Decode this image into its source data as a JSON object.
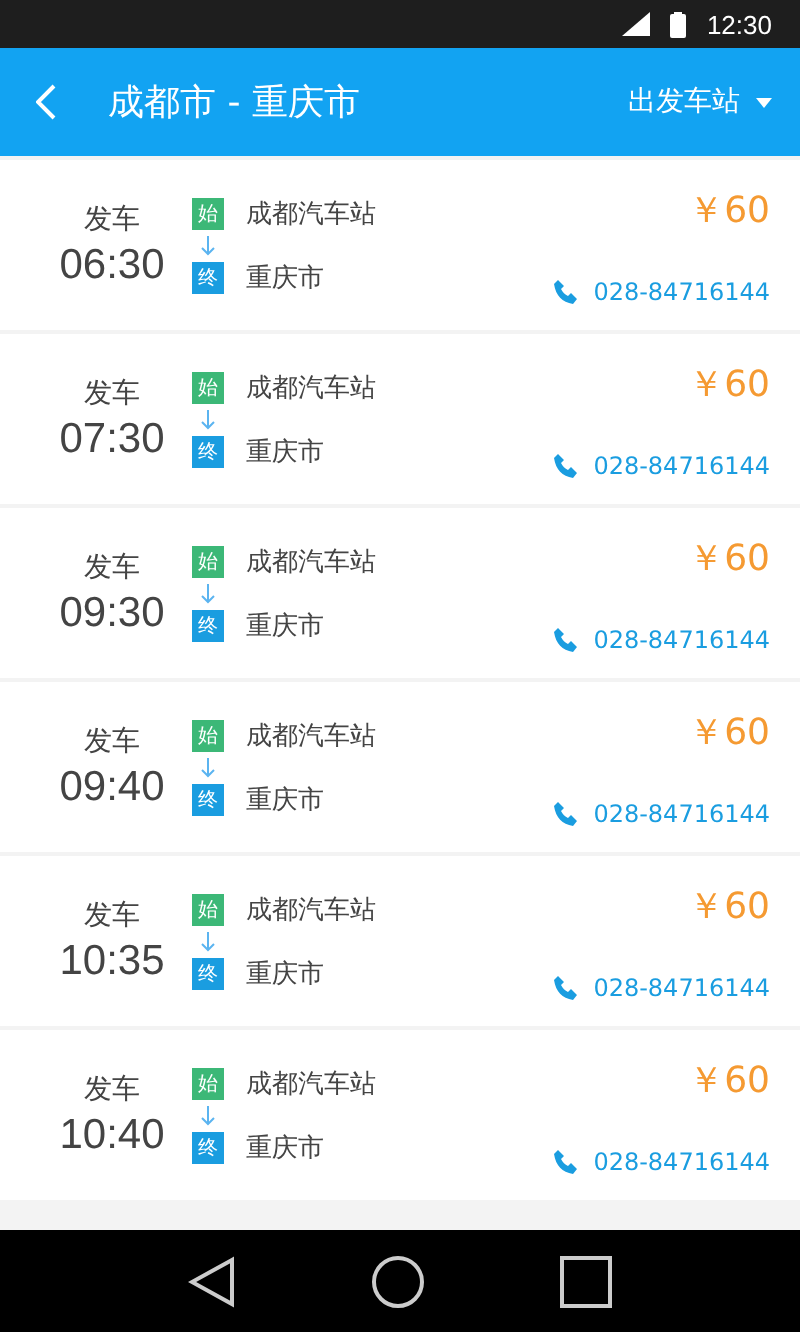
{
  "status_bar": {
    "time": "12:30"
  },
  "header": {
    "title": "成都市 - 重庆市",
    "filter": "出发车站"
  },
  "trips": [
    {
      "depart_label": "发车",
      "time": "06:30",
      "start_tag": "始",
      "start": "成都汽车站",
      "end_tag": "终",
      "end": "重庆市",
      "price": "￥60",
      "phone": "028-84716144"
    },
    {
      "depart_label": "发车",
      "time": "07:30",
      "start_tag": "始",
      "start": "成都汽车站",
      "end_tag": "终",
      "end": "重庆市",
      "price": "￥60",
      "phone": "028-84716144"
    },
    {
      "depart_label": "发车",
      "time": "09:30",
      "start_tag": "始",
      "start": "成都汽车站",
      "end_tag": "终",
      "end": "重庆市",
      "price": "￥60",
      "phone": "028-84716144"
    },
    {
      "depart_label": "发车",
      "time": "09:40",
      "start_tag": "始",
      "start": "成都汽车站",
      "end_tag": "终",
      "end": "重庆市",
      "price": "￥60",
      "phone": "028-84716144"
    },
    {
      "depart_label": "发车",
      "time": "10:35",
      "start_tag": "始",
      "start": "成都汽车站",
      "end_tag": "终",
      "end": "重庆市",
      "price": "￥60",
      "phone": "028-84716144"
    },
    {
      "depart_label": "发车",
      "time": "10:40",
      "start_tag": "始",
      "start": "成都汽车站",
      "end_tag": "终",
      "end": "重庆市",
      "price": "￥60",
      "phone": "028-84716144"
    }
  ]
}
